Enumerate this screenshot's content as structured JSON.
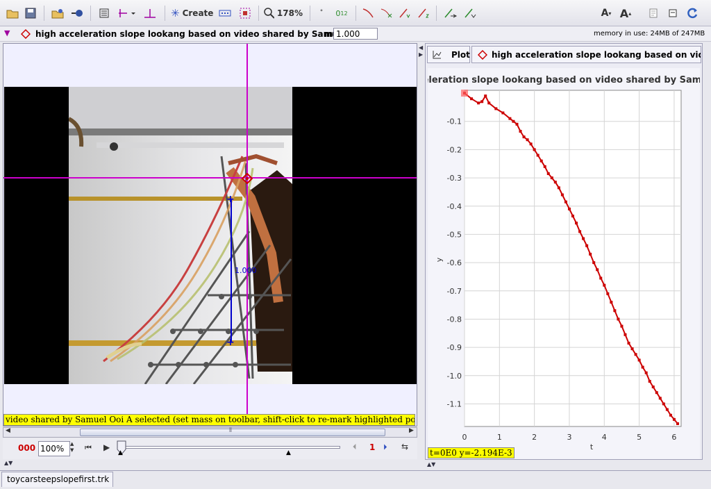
{
  "toolbar": {
    "create_label": "Create",
    "zoom_label": "178%",
    "coords_label": "0",
    "coords_sub": "1",
    "coords_sub2": "2"
  },
  "trackbar": {
    "track_name": "high acceleration slope lookang based on video shared by Samuel Ooi A",
    "mass_label": "m",
    "mass_value": "1.000",
    "memory_text": "memory in use: 24MB of 247MB"
  },
  "video": {
    "calibration_label": "1.000",
    "status_message": "video shared by Samuel Ooi A selected (set mass on toolbar, shift-click to re-mark highlighted position)"
  },
  "player": {
    "frame_counter": "000",
    "zoom_value": "100%",
    "step_value": "1"
  },
  "plot": {
    "tab_label": "Plot",
    "track_label": "high acceleration slope lookang based on video shared by Samuel Ooi A",
    "readout": "t=0E0  y=-2.194E-3"
  },
  "file_tab": "toycarsteepslopefirst.trk",
  "colors": {
    "accent_magenta": "#cc00cc",
    "track_red": "#cc0000",
    "calibration_blue": "#0000cc",
    "highlight_yellow": "#ffff00"
  },
  "chart_data": {
    "type": "scatter",
    "title": "high acceleration slope lookang based on video shared by Samuel Ooi A",
    "xlabel": "t",
    "ylabel": "y",
    "xlim": [
      0,
      6.2
    ],
    "ylim": [
      -1.18,
      0.01
    ],
    "xticks": [
      0,
      1,
      2,
      3,
      4,
      5,
      6
    ],
    "yticks": [
      -0.1,
      -0.2,
      -0.3,
      -0.4,
      -0.5,
      -0.6,
      -0.7,
      -0.8,
      -0.9,
      -1.0,
      -1.1
    ],
    "grid": true,
    "series": [
      {
        "points": [
          [
            0.0,
            0.0
          ],
          [
            0.2,
            -0.02
          ],
          [
            0.4,
            -0.035
          ],
          [
            0.5,
            -0.03
          ],
          [
            0.6,
            -0.01
          ],
          [
            0.7,
            -0.035
          ],
          [
            0.9,
            -0.055
          ],
          [
            1.1,
            -0.07
          ],
          [
            1.3,
            -0.09
          ],
          [
            1.4,
            -0.1
          ],
          [
            1.5,
            -0.11
          ],
          [
            1.6,
            -0.135
          ],
          [
            1.7,
            -0.155
          ],
          [
            1.8,
            -0.165
          ],
          [
            1.9,
            -0.18
          ],
          [
            2.0,
            -0.2
          ],
          [
            2.1,
            -0.22
          ],
          [
            2.2,
            -0.24
          ],
          [
            2.3,
            -0.26
          ],
          [
            2.4,
            -0.285
          ],
          [
            2.5,
            -0.3
          ],
          [
            2.6,
            -0.315
          ],
          [
            2.7,
            -0.335
          ],
          [
            2.8,
            -0.36
          ],
          [
            2.9,
            -0.385
          ],
          [
            3.0,
            -0.41
          ],
          [
            3.1,
            -0.435
          ],
          [
            3.2,
            -0.46
          ],
          [
            3.3,
            -0.49
          ],
          [
            3.4,
            -0.515
          ],
          [
            3.5,
            -0.54
          ],
          [
            3.6,
            -0.57
          ],
          [
            3.7,
            -0.6
          ],
          [
            3.8,
            -0.625
          ],
          [
            3.9,
            -0.655
          ],
          [
            4.0,
            -0.68
          ],
          [
            4.1,
            -0.71
          ],
          [
            4.2,
            -0.74
          ],
          [
            4.3,
            -0.77
          ],
          [
            4.4,
            -0.8
          ],
          [
            4.5,
            -0.825
          ],
          [
            4.6,
            -0.855
          ],
          [
            4.7,
            -0.885
          ],
          [
            4.8,
            -0.905
          ],
          [
            4.9,
            -0.925
          ],
          [
            5.0,
            -0.945
          ],
          [
            5.1,
            -0.97
          ],
          [
            5.2,
            -0.99
          ],
          [
            5.3,
            -1.02
          ],
          [
            5.4,
            -1.04
          ],
          [
            5.5,
            -1.06
          ],
          [
            5.6,
            -1.08
          ],
          [
            5.7,
            -1.1
          ],
          [
            5.8,
            -1.12
          ],
          [
            5.9,
            -1.14
          ],
          [
            6.0,
            -1.155
          ],
          [
            6.1,
            -1.17
          ]
        ]
      }
    ]
  }
}
